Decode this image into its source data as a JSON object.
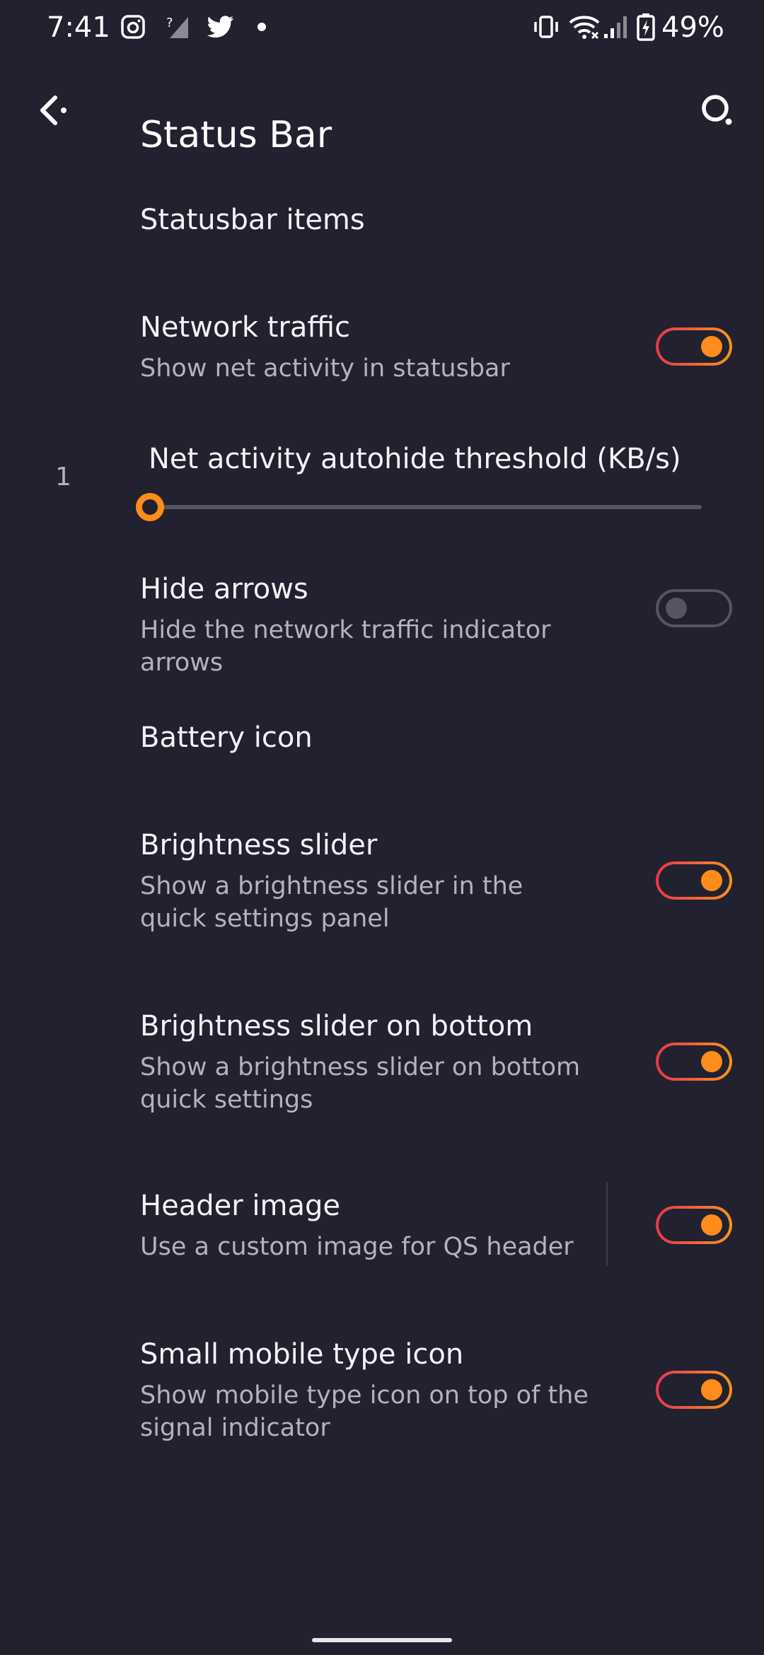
{
  "status_bar": {
    "time": "7:41",
    "battery_percent": "49%",
    "icons": [
      "instagram-icon",
      "no-signal-icon",
      "twitter-icon",
      "notification-dot-icon",
      "vibrate-icon",
      "wifi-icon",
      "cell-signal-icon",
      "battery-charging-icon"
    ]
  },
  "app_bar": {
    "title": "Status Bar",
    "back_icon": "back-arrow-icon",
    "search_icon": "search-icon"
  },
  "preferences": {
    "statusbar_items": {
      "title": "Statusbar items"
    },
    "network_traffic": {
      "title": "Network traffic",
      "summary": "Show net activity in statusbar",
      "enabled": true
    },
    "autohide_threshold": {
      "title": "Net activity autohide threshold (KB/s)",
      "value": "1",
      "fraction": 0.0
    },
    "hide_arrows": {
      "title": "Hide arrows",
      "summary": "Hide the network traffic indicator arrows",
      "enabled": false
    },
    "battery_icon": {
      "title": "Battery icon"
    },
    "brightness_slider": {
      "title": "Brightness slider",
      "summary": "Show a brightness slider in the quick settings panel",
      "enabled": true
    },
    "brightness_slider_bottom": {
      "title": "Brightness slider on bottom",
      "summary": "Show a brightness slider on bottom quick settings",
      "enabled": true
    },
    "header_image": {
      "title": "Header image",
      "summary": "Use a custom image for QS header",
      "enabled": true
    },
    "small_mobile_type_icon": {
      "title": "Small mobile type icon",
      "summary": "Show mobile type icon on top of the signal indicator",
      "enabled": true
    }
  },
  "colors": {
    "background": "#21212f",
    "accent": "#ff8c1a",
    "accent_gradient_start": "#e8364f",
    "text_primary": "#f2f2f6",
    "text_secondary": "#b3b3bd"
  }
}
